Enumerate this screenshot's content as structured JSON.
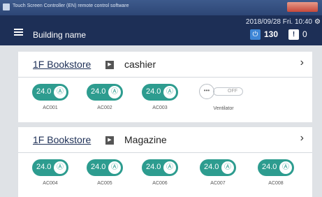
{
  "window": {
    "title": "Touch Screen Controller (EN) remote control software"
  },
  "header": {
    "building_name": "Building name",
    "datetime": "2018/09/28 Fri. 10:40",
    "power_count": "130",
    "alert_count": "0",
    "power_icon": "⏻",
    "alert_icon": "!"
  },
  "sections": [
    {
      "floor": "1F Bookstore",
      "area": "cashier",
      "units": [
        {
          "label": "AC001",
          "temp": "24.0",
          "type": "ac"
        },
        {
          "label": "AC002",
          "temp": "24.0",
          "type": "ac"
        },
        {
          "label": "AC003",
          "temp": "24.0",
          "type": "ac"
        },
        {
          "label": "Ventilator",
          "status": "OFF",
          "type": "ventilator",
          "button": "•••"
        }
      ]
    },
    {
      "floor": "1F Bookstore",
      "area": "Magazine",
      "units": [
        {
          "label": "AC004",
          "temp": "24.0",
          "type": "ac"
        },
        {
          "label": "AC005",
          "temp": "24.0",
          "type": "ac"
        },
        {
          "label": "AC006",
          "temp": "24.0",
          "type": "ac"
        },
        {
          "label": "AC007",
          "temp": "24.0",
          "type": "ac"
        },
        {
          "label": "AC008",
          "temp": "24.0",
          "type": "ac"
        }
      ]
    }
  ],
  "colors": {
    "header": "#1d2f56",
    "accent": "#2d9c8f",
    "power": "#3e86d6"
  }
}
